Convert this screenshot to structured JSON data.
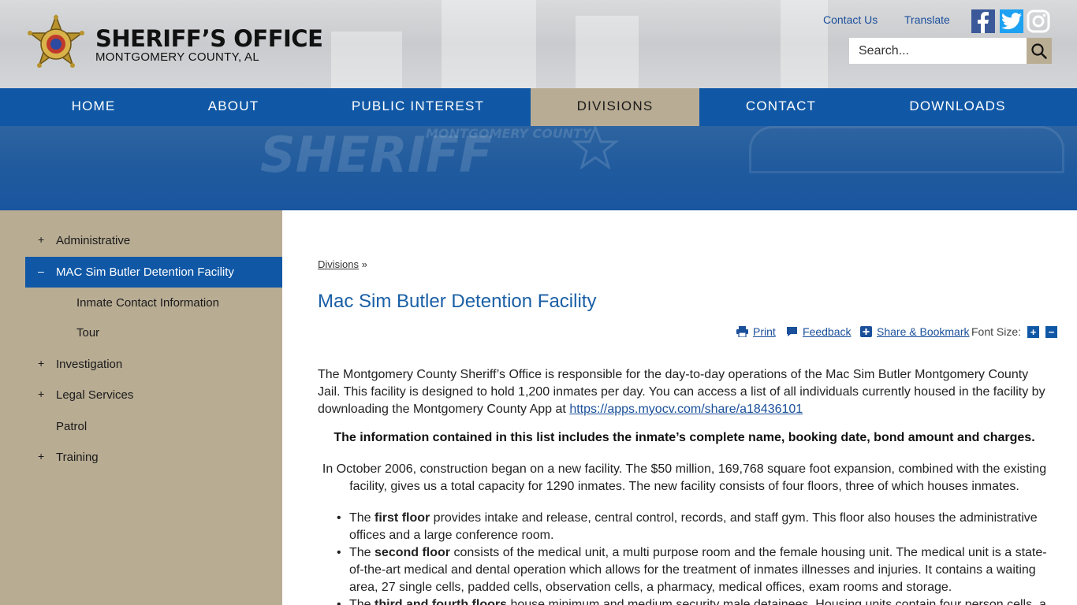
{
  "header": {
    "logo_title": "SHERIFF’S OFFICE",
    "logo_subtitle": "MONTGOMERY COUNTY, AL",
    "links": {
      "contact": "Contact Us",
      "translate": "Translate"
    },
    "search": {
      "placeholder": "Search..."
    },
    "social": [
      "facebook-icon",
      "twitter-icon",
      "instagram-icon"
    ]
  },
  "nav": {
    "items": [
      {
        "label": "HOME"
      },
      {
        "label": "ABOUT"
      },
      {
        "label": "PUBLIC INTEREST"
      },
      {
        "label": "DIVISIONS",
        "active": true
      },
      {
        "label": "CONTACT"
      },
      {
        "label": "DOWNLOADS"
      }
    ]
  },
  "banner": {
    "text_1": "SHERIFF",
    "text_2": "MONTGOMERY COUNTY"
  },
  "sidebar": {
    "items": [
      {
        "sign": "+",
        "label": "Administrative"
      },
      {
        "sign": "–",
        "label": "MAC Sim Butler Detention Facility",
        "active": true
      },
      {
        "label": "Inmate Contact Information"
      },
      {
        "label": "Tour"
      },
      {
        "sign": "+",
        "label": "Investigation"
      },
      {
        "sign": "+",
        "label": "Legal Services"
      },
      {
        "label": "Patrol"
      },
      {
        "sign": "+",
        "label": "Training"
      }
    ]
  },
  "main": {
    "breadcrumb": {
      "link": "Divisions",
      "sep": "»"
    },
    "title": "Mac Sim Butler Detention Facility",
    "tools": {
      "print": "Print",
      "feedback": "Feedback",
      "share": "Share & Bookmark",
      "font_size": "Font Size:",
      "plus": "+",
      "minus": "−"
    },
    "para1": "The Montgomery County Sheriff’s Office is responsible for the day-to-day operations of the Mac Sim Butler Montgomery County Jail. This facility is designed to hold 1,200 inmates per day. You can access a list of all individuals currently housed in the facility by downloading the Montgomery County App at ",
    "para1_link": "https://apps.myocv.com/share/a18436101",
    "bold_line": "The information contained in this list includes the inmate’s complete name, booking date, bond amount and charges.",
    "para2": "In October 2006, construction began on a new facility. The $50 million, 169,768 square foot expansion, combined with the existing facility, gives us a total capacity for 1290 inmates. The new facility consists of four floors, three of which houses inmates.",
    "bullets": [
      {
        "pre": "The ",
        "bold": "first floor",
        "rest": " provides intake and release, central control, records, and staff gym. This floor also houses the administrative offices and a large conference room."
      },
      {
        "pre": "The ",
        "bold": "second floor",
        "rest": " consists of the medical unit, a multi purpose room and the female housing unit. The medical unit is a state-of-the-art medical and dental operation which allows for the treatment of inmates illnesses and injuries. It contains a waiting area, 27 single cells, padded cells, observation cells, a pharmacy, medical offices, exam rooms and storage."
      },
      {
        "pre": "The ",
        "bold": "third and fourth floors",
        "rest": " house minimum and medium security male detainees. Housing units contain four person cells, a"
      }
    ]
  }
}
